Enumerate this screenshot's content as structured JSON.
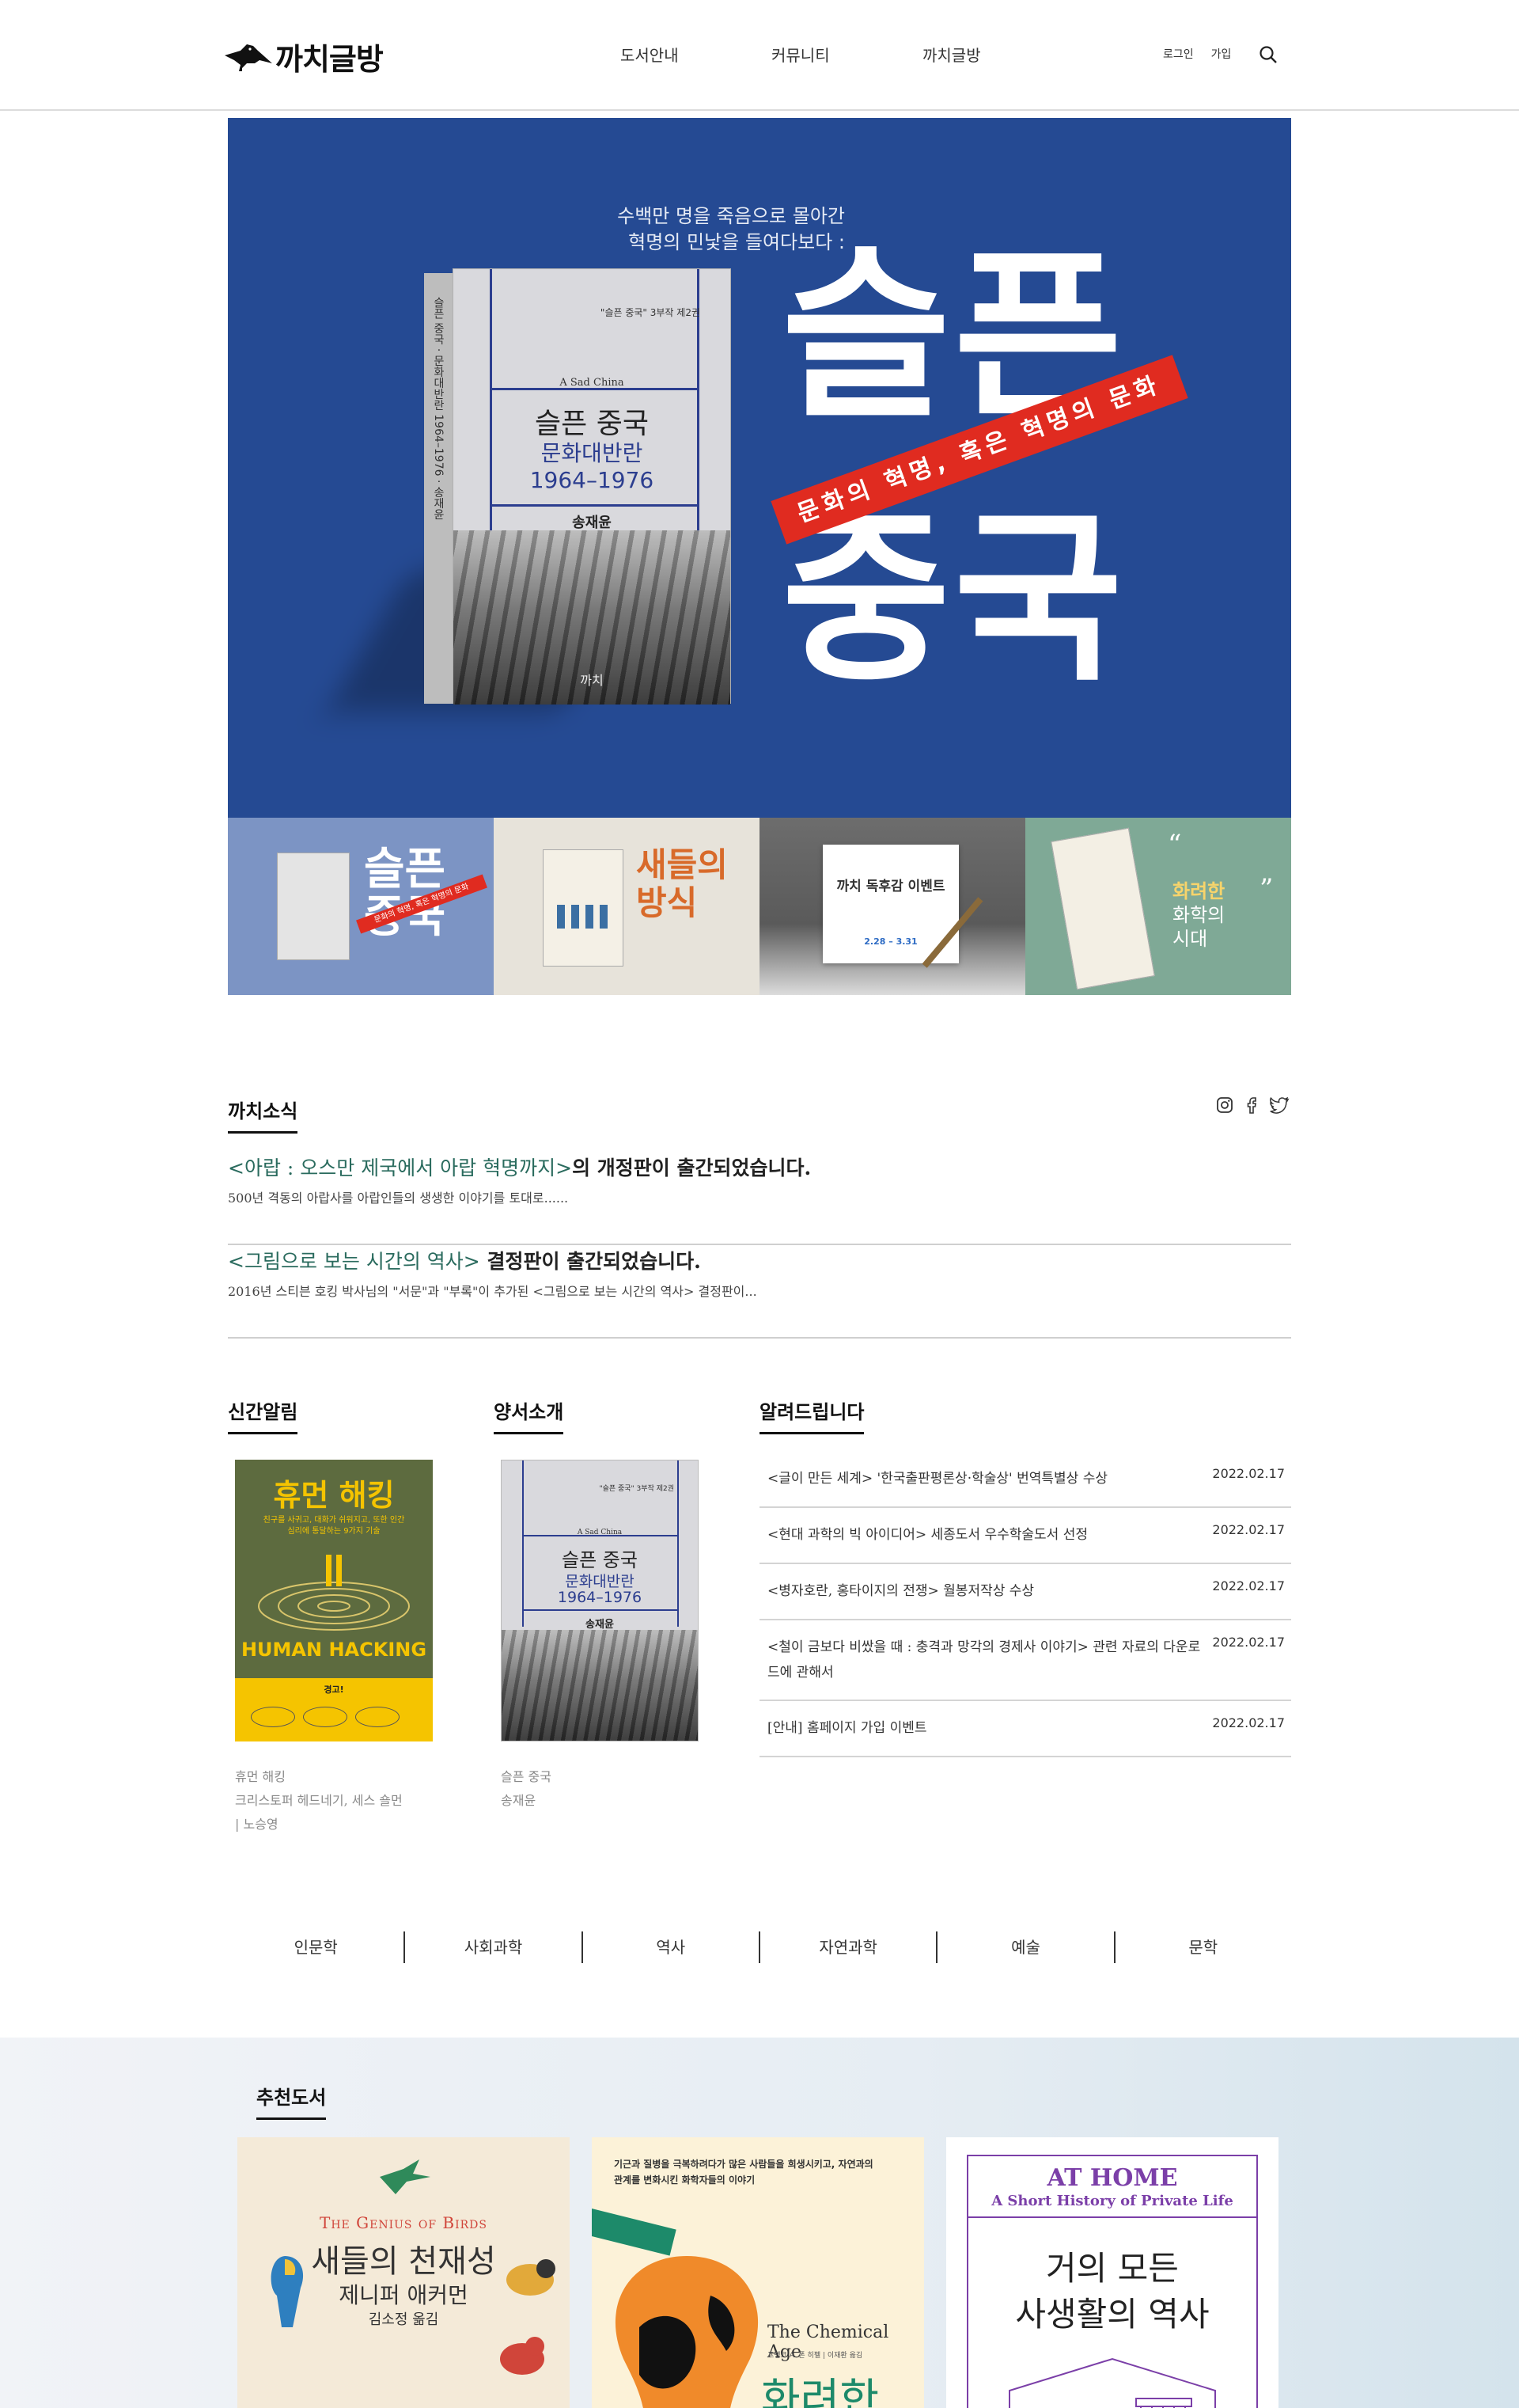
{
  "header": {
    "logo_text": "까치글방",
    "nav": [
      "도서안내",
      "커뮤니티",
      "까치글방"
    ],
    "login": "로그인",
    "signup": "가입"
  },
  "hero": {
    "tagline_1": "수백만 명을 죽음으로 몰아간",
    "tagline_2": "혁명의 민낯을 들여다보다 :",
    "book_series": "\"슬픈 중국\" 3부작 제2권",
    "book_en_title": "A Sad China",
    "book_title": "슬픈 중국",
    "book_subtitle": "문화대반란",
    "book_years": "1964–1976",
    "book_author": "송재윤",
    "book_publisher": "까치",
    "spine_text": "슬픈 중국 · 문화대반란 1964–1976 · 송재윤",
    "big_title_1": "슬픈",
    "big_title_2": "중국",
    "ribbon": "문화의 혁명, 혹은 혁명의 문화",
    "colors": {
      "bg": "#254A93",
      "ribbon": "#E02B20"
    }
  },
  "thumbs": [
    {
      "title_1": "슬픈",
      "title_2": "중국",
      "ribbon": "문화의 혁명, 혹은 혁명의 문화"
    },
    {
      "title_1": "새들의",
      "title_2": "방식"
    },
    {
      "title": "까치 독후감 이벤트",
      "date": "2.28 – 3.31"
    },
    {
      "title_1": "화려한",
      "title_2": "화학의",
      "title_3": "시대"
    }
  ],
  "news": {
    "title": "까치소식",
    "items": [
      {
        "highlight": "<아랍 : 오스만 제국에서 아랍 혁명까지>",
        "rest": "의 개정판이 출간되었습니다.",
        "desc": "500년 격동의 아랍사를 아랍인들의 생생한 이야기를 토대로......"
      },
      {
        "highlight": "<그림으로 보는 시간의 역사>",
        "rest": " 결정판이 출간되었습니다.",
        "desc": "2016년 스티븐 호킹 박사님의 \"서문\"과 \"부록\"이 추가된 <그림으로 보는 시간의 역사> 결정판이..."
      }
    ]
  },
  "new_books": {
    "title": "신간알림",
    "cover_title": "휴먼 해킹",
    "cover_tagline": "친구를 사귀고, 대화가 쉬워지고, 또한 인간 심리에 통달하는 9가지 기술",
    "cover_en": "HUMAN HACKING",
    "cover_warning": "경고!",
    "meta": [
      "휴먼 해킹",
      "크리스토퍼 헤드네기, 세스 숄먼",
      "| 노승영"
    ]
  },
  "good_books": {
    "title": "양서소개",
    "cover_series": "\"슬픈 중국\" 3부작 제2권",
    "cover_en": "A Sad China",
    "cover_title": "슬픈 중국",
    "cover_subtitle": "문화대반란",
    "cover_years": "1964–1976",
    "cover_author": "송재윤",
    "meta": [
      "슬픈 중국",
      "송재윤"
    ]
  },
  "notices": {
    "title": "알려드립니다",
    "items": [
      {
        "text": "<글이 만든 세계> '한국출판평론상·학술상' 번역특별상 수상",
        "date": "2022.02.17"
      },
      {
        "text": "<현대 과학의 빅 아이디어> 세종도서 우수학술도서 선정",
        "date": "2022.02.17"
      },
      {
        "text": "<병자호란, 홍타이지의 전쟁> 월봉저작상 수상",
        "date": "2022.02.17"
      },
      {
        "text": "<철이 금보다 비쌌을 때 : 충격과 망각의 경제사 이야기> 관련 자료의 다운로드에 관해서",
        "date": "2022.02.17"
      },
      {
        "text": "[안내] 홈페이지 가입 이벤트",
        "date": "2022.02.17"
      }
    ]
  },
  "categories": [
    "인문학",
    "사회과학",
    "역사",
    "자연과학",
    "예술",
    "문학"
  ],
  "recommended": {
    "title": "추천도서",
    "books": [
      {
        "en": "The Genius of Birds",
        "title": "새들의 천재성",
        "author": "제니퍼 애커먼",
        "translator": "김소정 옮김"
      },
      {
        "tagline": "기근과 질병을 극복하려다가 많은 사람들을 희생시키고, 자연과의 관계를 변화시킨 화학자들의 이야기",
        "en": "The Chemical Age",
        "author": "프랭크 A. 폰 히펠 | 이재환 옮김",
        "title": "화려한"
      },
      {
        "en_1": "AT HOME",
        "en_2": "A Short History of Private Life",
        "title_1": "거의 모든",
        "title_2": "사생활의 역사"
      }
    ]
  }
}
